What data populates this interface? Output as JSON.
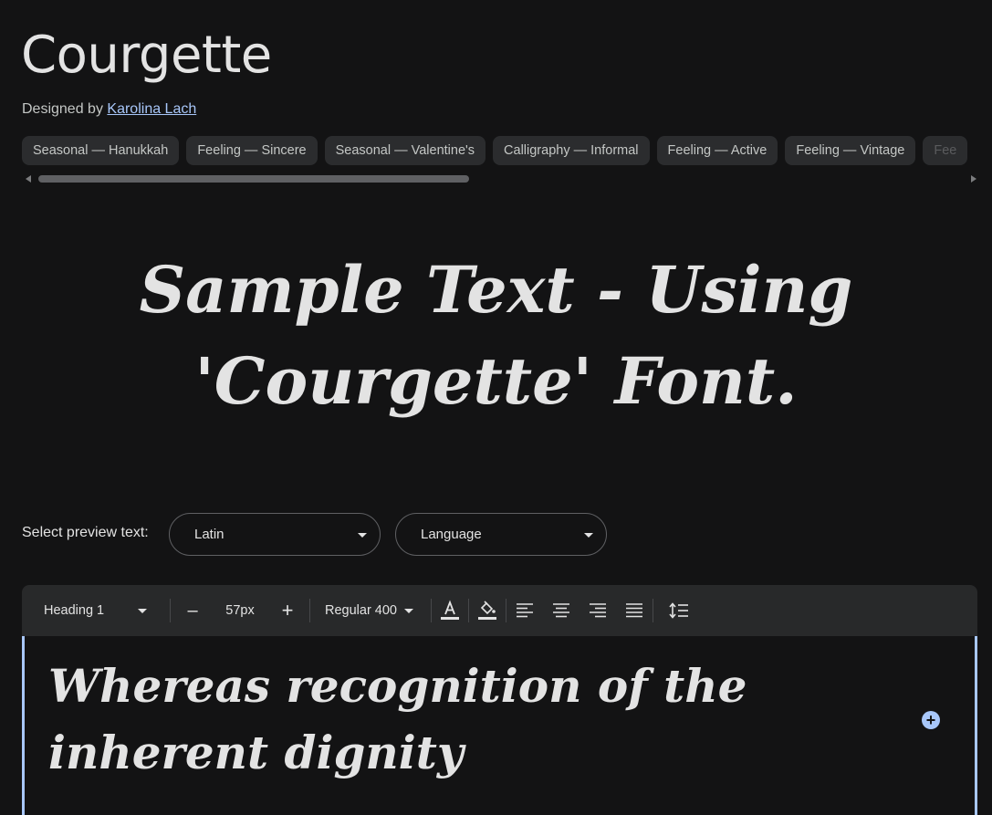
{
  "font": {
    "name": "Courgette",
    "designed_by_prefix": "Designed by",
    "designer": "Karolina Lach"
  },
  "tags": [
    "Seasonal — Hanukkah",
    "Feeling — Sincere",
    "Seasonal — Valentine's",
    "Calligraphy — Informal",
    "Feeling — Active",
    "Feeling — Vintage",
    "Fee"
  ],
  "sample_text": {
    "line1": "Sample Text - Using",
    "line2": "'Courgette' Font."
  },
  "preview": {
    "label": "Select preview text:",
    "script_select": "Latin",
    "language_select": "Language"
  },
  "toolbar": {
    "style": "Heading 1",
    "decrease": "–",
    "size": "57px",
    "increase": "+",
    "weight": "Regular 400"
  },
  "editor": {
    "text": "Whereas recognition of the inherent dignity",
    "add_label": "+"
  },
  "colors": {
    "background": "#131314",
    "accent": "#a8c7fa",
    "chip": "#2b2c2e",
    "toolbar": "#28292a"
  }
}
